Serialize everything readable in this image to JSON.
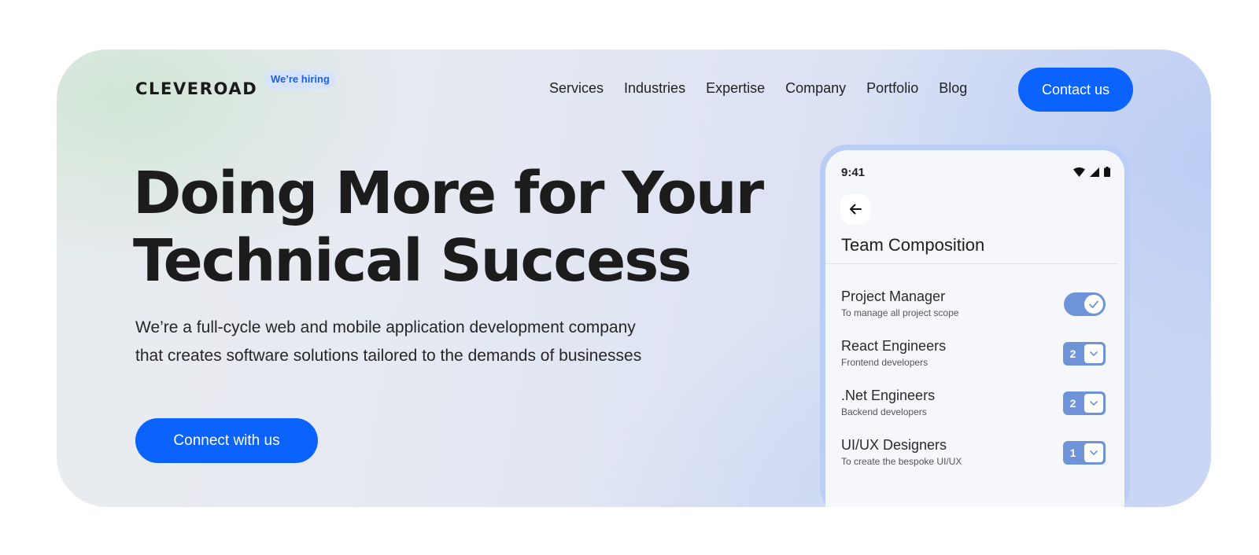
{
  "header": {
    "logo": "CLEVEROAD",
    "hiring_badge": "We’re hiring",
    "nav": [
      "Services",
      "Industries",
      "Expertise",
      "Company",
      "Portfolio",
      "Blog"
    ],
    "contact_label": "Contact us"
  },
  "hero": {
    "headline_line1": "Doing More for Your",
    "headline_line2": "Technical Success",
    "subtitle_line1": "We’re a full-cycle web and mobile application development company",
    "subtitle_line2": "that creates software solutions tailored to the demands of businesses",
    "cta_label": "Connect with us"
  },
  "phone": {
    "time": "9:41",
    "status_icons": [
      "wifi-icon",
      "signal-icon",
      "battery-icon"
    ],
    "back_icon": "arrow-left-icon",
    "title": "Team Composition",
    "roles": [
      {
        "name": "Project Manager",
        "desc": "To manage all project scope",
        "control": "toggle",
        "checked": true
      },
      {
        "name": "React Engineers",
        "desc": "Frontend developers",
        "control": "stepper",
        "count": "2"
      },
      {
        "name": ".Net Engineers",
        "desc": "Backend developers",
        "control": "stepper",
        "count": "2"
      },
      {
        "name": "UI/UX Designers",
        "desc": "To create the bespoke UI/UX",
        "control": "stepper",
        "count": "1"
      }
    ]
  },
  "colors": {
    "accent": "#0a63ff",
    "control": "#6e93d8",
    "badge_bg": "#d6e3fb"
  }
}
